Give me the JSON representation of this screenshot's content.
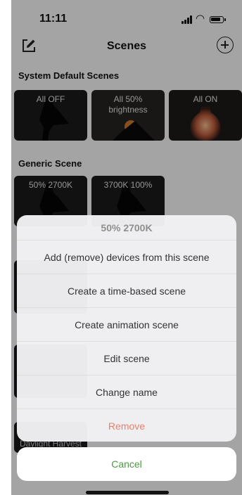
{
  "status_bar": {
    "time": "11:11"
  },
  "header": {
    "title": "Scenes"
  },
  "sections": {
    "system": {
      "title": "System Default Scenes",
      "scenes": [
        {
          "label": "All OFF"
        },
        {
          "label": "All 50%\nbrightness"
        },
        {
          "label": "All ON"
        }
      ]
    },
    "generic": {
      "title": "Generic Scene",
      "scenes": [
        {
          "label": "50% 2700K"
        },
        {
          "label": "3700K 100%"
        }
      ]
    },
    "hidden_tile_label": "Daylight Harvest"
  },
  "action_sheet": {
    "title": "50% 2700K",
    "items": [
      {
        "label": "Add (remove) devices from this scene"
      },
      {
        "label": "Create a time-based scene"
      },
      {
        "label": "Create animation scene"
      },
      {
        "label": "Edit scene"
      },
      {
        "label": "Change name"
      },
      {
        "label": "Remove",
        "color": "#ec7f6a"
      }
    ],
    "cancel_label": "Cancel",
    "cancel_color": "#4c9a3e"
  }
}
